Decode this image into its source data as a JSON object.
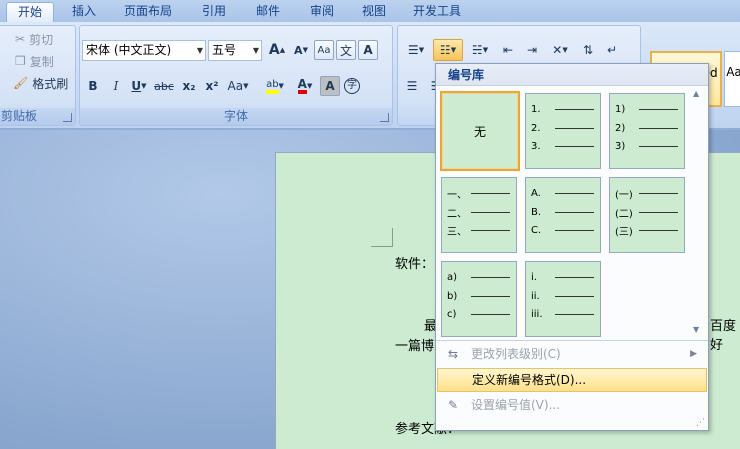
{
  "tabs": [
    "开始",
    "插入",
    "页面布局",
    "引用",
    "邮件",
    "审阅",
    "视图",
    "开发工具"
  ],
  "clipboard": {
    "cut": "剪切",
    "copy": "复制",
    "format_painter": "格式刷",
    "group_label": "剪贴板"
  },
  "font": {
    "name": "宋体 (中文正文)",
    "size": "五号",
    "group_label": "字体",
    "bold": "B",
    "italic": "I",
    "underline": "U",
    "strike": "abc",
    "subscript": "x₂",
    "superscript": "x²",
    "change_case": "Aa",
    "grow": "A",
    "shrink": "A",
    "phonetic": "文",
    "border": "A",
    "shade": "A",
    "enclose": "字",
    "highlight": "ab",
    "font_color": "A"
  },
  "styles": {
    "sample": "AaBbCcDd",
    "sample2": "Aa"
  },
  "document": {
    "line1": "软件：",
    "line2a": "最",
    "line2b": "百度好",
    "line3": "一篇博",
    "line4": "参考文献："
  },
  "numbering_menu": {
    "header": "编号库",
    "none_label": "无",
    "tiles": [
      [
        "1.",
        "2.",
        "3."
      ],
      [
        "1)",
        "2)",
        "3)"
      ],
      [
        "一、",
        "二、",
        "三、"
      ],
      [
        "A.",
        "B.",
        "C."
      ],
      [
        "(一)",
        "(二)",
        "(三)"
      ],
      [
        "a)",
        "b)",
        "c)"
      ],
      [
        "i.",
        "ii.",
        "iii."
      ]
    ],
    "change_level": "更改列表级别(C)",
    "define_new": "定义新编号格式(D)...",
    "set_value": "设置编号值(V)..."
  }
}
